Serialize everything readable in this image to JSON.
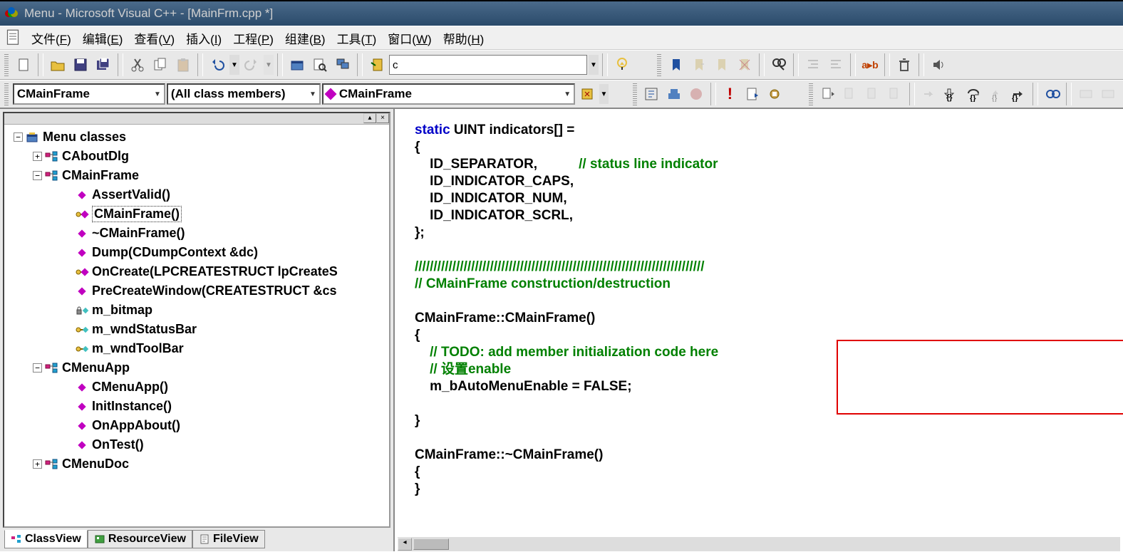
{
  "title": "Menu - Microsoft Visual C++ - [MainFrm.cpp *]",
  "menubar": {
    "items": [
      {
        "label": "文件",
        "accel": "F"
      },
      {
        "label": "编辑",
        "accel": "E"
      },
      {
        "label": "查看",
        "accel": "V"
      },
      {
        "label": "插入",
        "accel": "I"
      },
      {
        "label": "工程",
        "accel": "P"
      },
      {
        "label": "组建",
        "accel": "B"
      },
      {
        "label": "工具",
        "accel": "T"
      },
      {
        "label": "窗口",
        "accel": "W"
      },
      {
        "label": "帮助",
        "accel": "H"
      }
    ]
  },
  "toolbar1": {
    "search_value": "c"
  },
  "class_bar": {
    "class_combo": "CMainFrame",
    "filter_combo": "(All class members)",
    "member_combo": "CMainFrame"
  },
  "tree": {
    "root": "Menu classes",
    "nodes": [
      {
        "type": "class",
        "label": "CAboutDlg",
        "exp": "+"
      },
      {
        "type": "class",
        "label": "CMainFrame",
        "exp": "-",
        "children": [
          {
            "icon": "fn-pub",
            "label": "AssertValid()"
          },
          {
            "icon": "fn-key",
            "label": "CMainFrame()",
            "selected": true
          },
          {
            "icon": "fn-pub",
            "label": "~CMainFrame()"
          },
          {
            "icon": "fn-pub",
            "label": "Dump(CDumpContext &dc)"
          },
          {
            "icon": "fn-key",
            "label": "OnCreate(LPCREATESTRUCT lpCreateS"
          },
          {
            "icon": "fn-pub",
            "label": "PreCreateWindow(CREATESTRUCT &cs"
          },
          {
            "icon": "var-lock",
            "label": "m_bitmap"
          },
          {
            "icon": "var-key",
            "label": "m_wndStatusBar"
          },
          {
            "icon": "var-key",
            "label": "m_wndToolBar"
          }
        ]
      },
      {
        "type": "class",
        "label": "CMenuApp",
        "exp": "-",
        "children": [
          {
            "icon": "fn-pub",
            "label": "CMenuApp()"
          },
          {
            "icon": "fn-pub",
            "label": "InitInstance()"
          },
          {
            "icon": "fn-pub",
            "label": "OnAppAbout()"
          },
          {
            "icon": "fn-pub",
            "label": "OnTest()"
          }
        ]
      },
      {
        "type": "class",
        "label": "CMenuDoc",
        "exp": "+"
      }
    ]
  },
  "tabs": {
    "items": [
      "ClassView",
      "ResourceView",
      "FileView"
    ],
    "active": 0
  },
  "code": {
    "lines": [
      {
        "t": "kw",
        "s": "static"
      },
      {
        "t": "txt",
        "s": " UINT indicators[] ="
      },
      {
        "t": "nl"
      },
      {
        "t": "txt",
        "s": "{"
      },
      {
        "t": "nl"
      },
      {
        "t": "txt",
        "s": "    ID_SEPARATOR,           "
      },
      {
        "t": "com",
        "s": "// status line indicator"
      },
      {
        "t": "nl"
      },
      {
        "t": "txt",
        "s": "    ID_INDICATOR_CAPS,"
      },
      {
        "t": "nl"
      },
      {
        "t": "txt",
        "s": "    ID_INDICATOR_NUM,"
      },
      {
        "t": "nl"
      },
      {
        "t": "txt",
        "s": "    ID_INDICATOR_SCRL,"
      },
      {
        "t": "nl"
      },
      {
        "t": "txt",
        "s": "};"
      },
      {
        "t": "nl"
      },
      {
        "t": "nl"
      },
      {
        "t": "com",
        "s": "/////////////////////////////////////////////////////////////////////////////"
      },
      {
        "t": "nl"
      },
      {
        "t": "com",
        "s": "// CMainFrame construction/destruction"
      },
      {
        "t": "nl"
      },
      {
        "t": "nl"
      },
      {
        "t": "txt",
        "s": "CMainFrame::CMainFrame()"
      },
      {
        "t": "nl"
      },
      {
        "t": "txt",
        "s": "{"
      },
      {
        "t": "nl"
      },
      {
        "t": "txt",
        "s": "    "
      },
      {
        "t": "com",
        "s": "// TODO: add member initialization code here"
      },
      {
        "t": "nl"
      },
      {
        "t": "txt",
        "s": "    "
      },
      {
        "t": "com",
        "s": "// 设置enable"
      },
      {
        "t": "nl"
      },
      {
        "t": "txt",
        "s": "    m_bAutoMenuEnable = FALSE;"
      },
      {
        "t": "nl"
      },
      {
        "t": "nl"
      },
      {
        "t": "txt",
        "s": "}"
      },
      {
        "t": "nl"
      },
      {
        "t": "nl"
      },
      {
        "t": "txt",
        "s": "CMainFrame::~CMainFrame()"
      },
      {
        "t": "nl"
      },
      {
        "t": "txt",
        "s": "{"
      },
      {
        "t": "nl"
      },
      {
        "t": "txt",
        "s": "}"
      }
    ]
  }
}
